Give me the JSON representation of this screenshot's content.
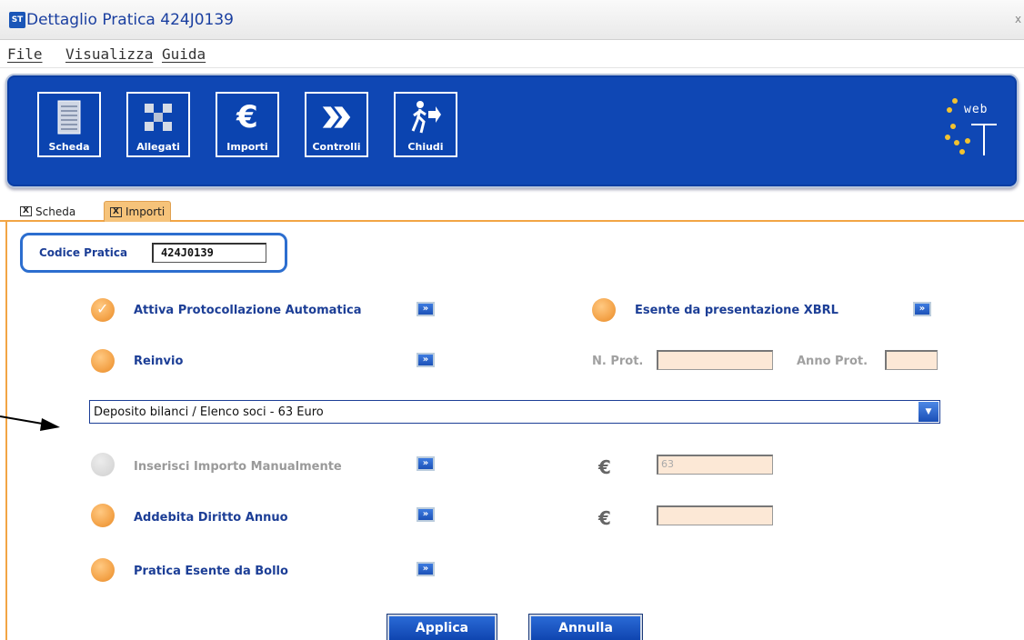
{
  "window": {
    "app_icon": "ST",
    "title": "Dettaglio Pratica 424J0139",
    "close": "x"
  },
  "menu": [
    {
      "label": "File"
    },
    {
      "label": "Visualizza"
    },
    {
      "label": "Guida"
    }
  ],
  "toolbar": {
    "buttons": [
      {
        "label": "Scheda",
        "icon": "document-icon"
      },
      {
        "label": "Allegati",
        "icon": "attachments-icon"
      },
      {
        "label": "Importi",
        "icon": "euro-icon"
      },
      {
        "label": "Controlli",
        "icon": "double-chevron-icon"
      },
      {
        "label": "Chiudi",
        "icon": "exit-icon"
      }
    ],
    "logo_text": "web",
    "logo_letter": "T"
  },
  "tabs": [
    {
      "label": "Scheda",
      "close": "X",
      "active": false
    },
    {
      "label": "Importi",
      "close": "X",
      "active": true
    }
  ],
  "codice": {
    "label": "Codice Pratica",
    "value": "424J0139"
  },
  "options": {
    "protocollazione": {
      "label": "Attiva Protocollazione Automatica",
      "checked": true
    },
    "xbrl": {
      "label": "Esente da presentazione XBRL",
      "checked": false
    },
    "reinvio": {
      "label": "Reinvio",
      "checked": false
    },
    "manuale": {
      "label": "Inserisci Importo Manualmente",
      "enabled": false
    },
    "diritto": {
      "label": "Addebita Diritto Annuo",
      "checked": false
    },
    "bollo": {
      "label": "Pratica Esente da Bollo",
      "checked": false
    }
  },
  "go_glyph": "»",
  "fields": {
    "n_prot_label": "N. Prot.",
    "n_prot_value": "",
    "anno_prot_label": "Anno Prot.",
    "anno_prot_value": "",
    "importo_value": "63",
    "diritto_value": "",
    "euro_symbol": "€"
  },
  "tariffa": {
    "selected": "Deposito bilanci / Elenco soci - 63 Euro",
    "arrow": "▼"
  },
  "actions": {
    "apply": "Applica",
    "cancel": "Annulla"
  },
  "colors": {
    "toolbar_blue": "#0f47b4",
    "accent_orange": "#f4a44a",
    "label_blue": "#1c3e96",
    "input_peach": "#fce8d6"
  }
}
